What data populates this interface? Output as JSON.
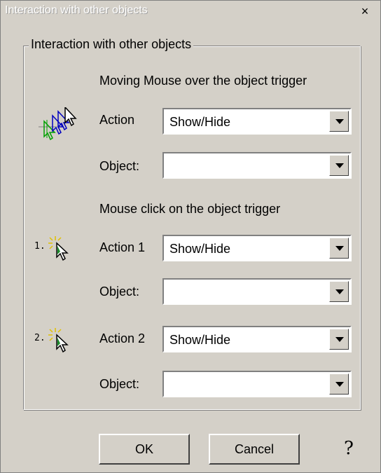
{
  "window": {
    "title": "Interaction with other objects",
    "close_label": "×"
  },
  "group": {
    "legend": "Interaction with other objects"
  },
  "mouseover": {
    "header": "Moving Mouse over the object trigger",
    "action_label": "Action",
    "action_value": "Show/Hide",
    "object_label": "Object:",
    "object_value": ""
  },
  "click": {
    "header": "Mouse click on the object trigger",
    "action1": {
      "number": "1.",
      "label": "Action 1",
      "value": "Show/Hide",
      "object_label": "Object:",
      "object_value": ""
    },
    "action2": {
      "number": "2.",
      "label": "Action 2",
      "value": "Show/Hide",
      "object_label": "Object:",
      "object_value": ""
    }
  },
  "buttons": {
    "ok": "OK",
    "cancel": "Cancel",
    "help": "?"
  },
  "icons": {
    "mouseover": "mouse-trail-icon",
    "click1": "mouse-click-icon",
    "click2": "mouse-click-icon"
  }
}
